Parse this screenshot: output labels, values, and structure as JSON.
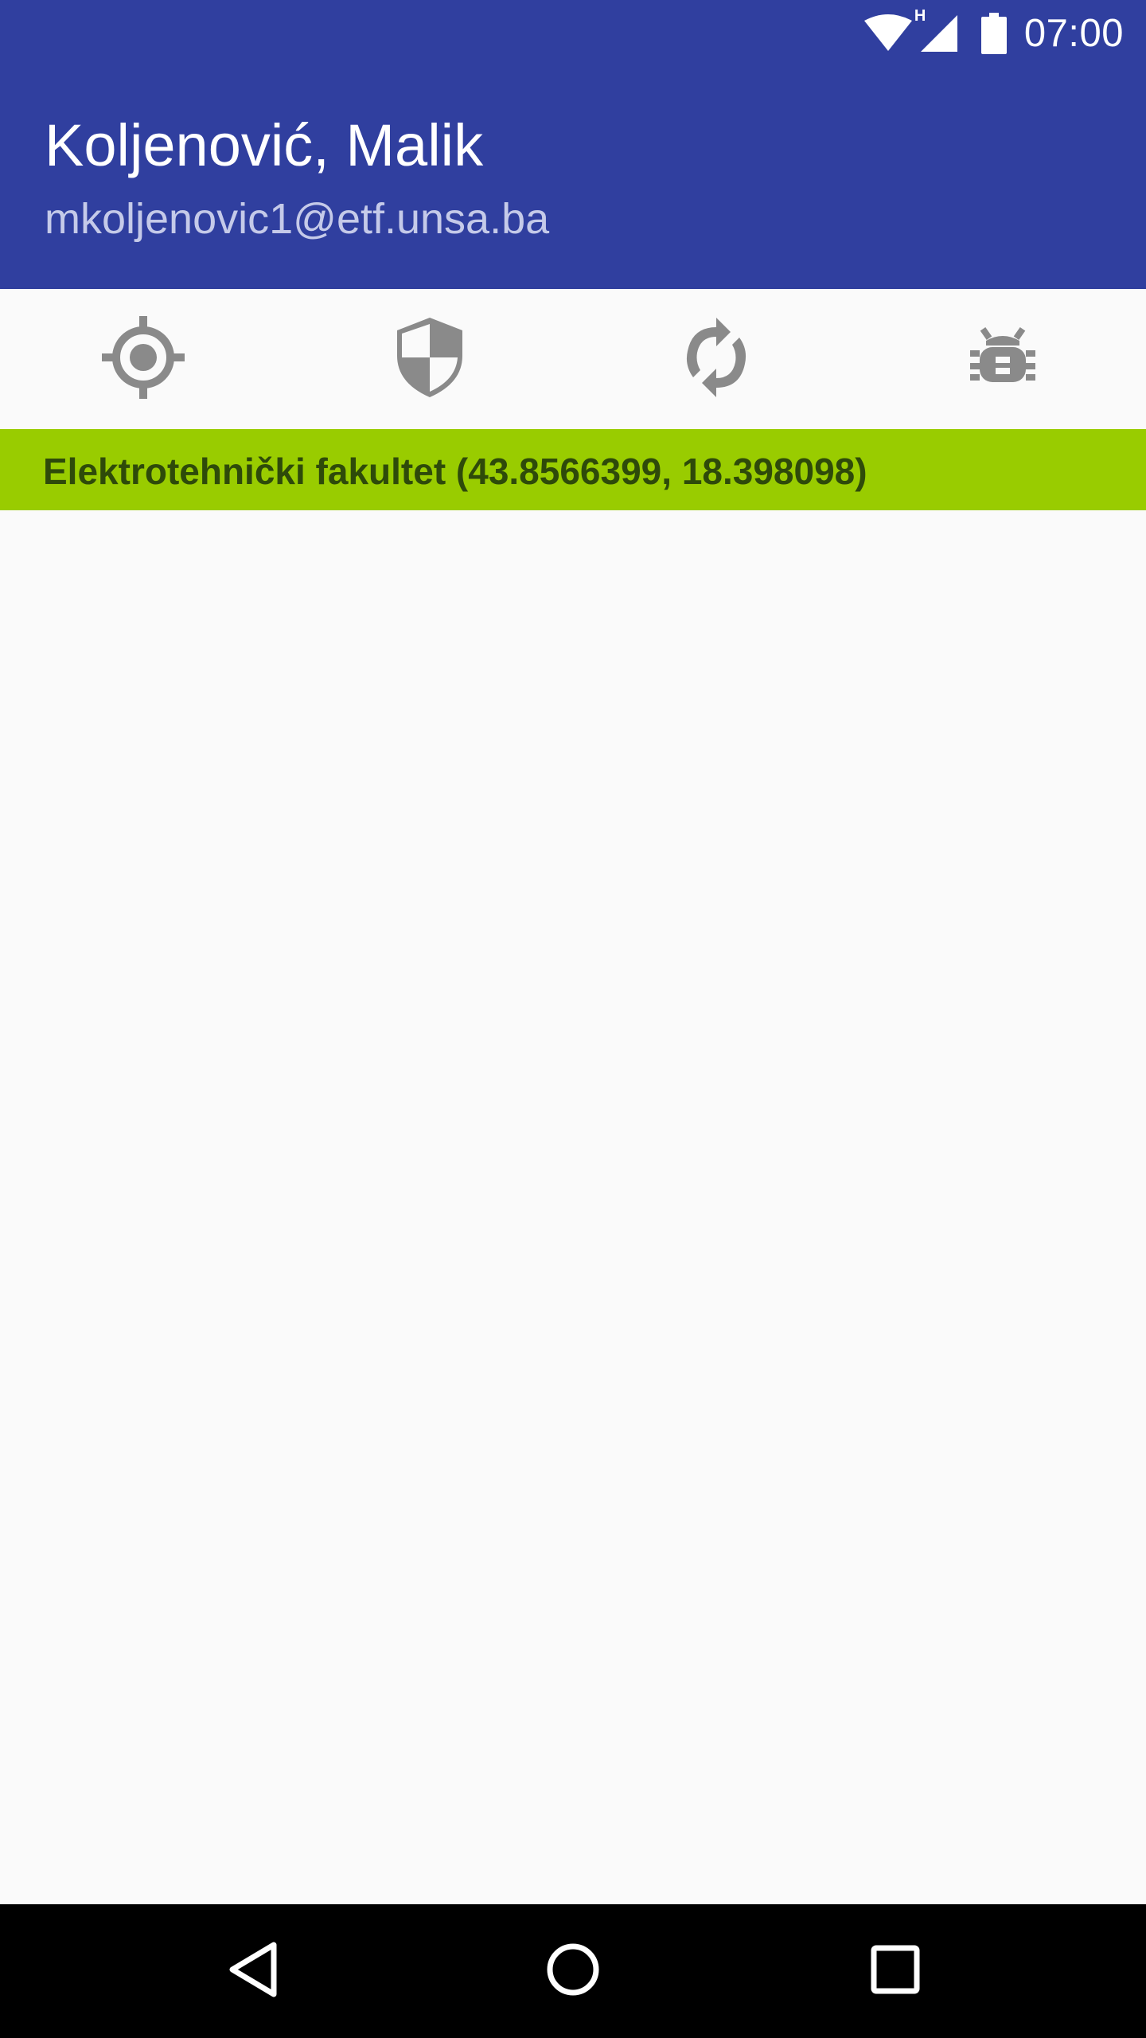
{
  "status_bar": {
    "time": "07:00",
    "network_type": "H",
    "icons": [
      "wifi-icon",
      "cell-signal-icon",
      "battery-icon"
    ]
  },
  "header": {
    "name": "Koljenović, Malik",
    "email": "mkoljenovic1@etf.unsa.ba",
    "background_color": "#303f9f"
  },
  "toolbar": {
    "icons": [
      "gps-target-icon",
      "shield-icon",
      "sync-icon",
      "bug-icon"
    ],
    "icon_color": "#8a8a8a"
  },
  "location": {
    "text": "Elektrotehnički fakultet (43.8566399, 18.398098)",
    "background_color": "#99cc00"
  },
  "nav_bar": {
    "buttons": [
      "back-icon",
      "home-icon",
      "recents-icon"
    ]
  }
}
